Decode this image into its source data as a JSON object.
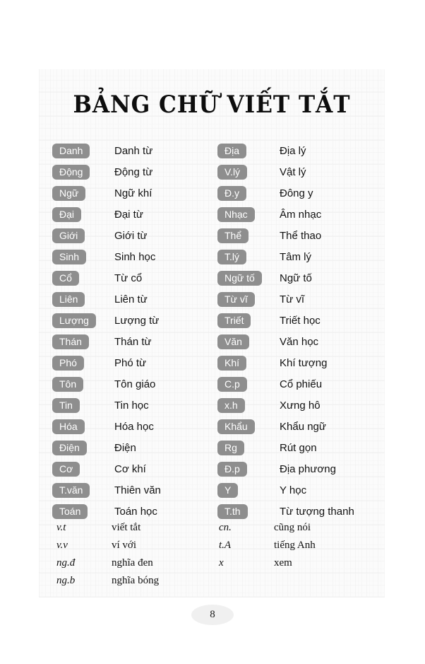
{
  "title": "BẢNG CHỮ VIẾT TẮT",
  "page_number": "8",
  "colors": {
    "badge_background": "#8e8e8e",
    "badge_text": "#ffffff",
    "definition_text": "#121212",
    "page_background": "#f7f7f7",
    "page_number_pill": "#f0f0f0"
  },
  "badge_columns": {
    "left": [
      {
        "abbr": "Danh",
        "definition": "Danh từ"
      },
      {
        "abbr": "Động",
        "definition": "Động từ"
      },
      {
        "abbr": "Ngữ",
        "definition": "Ngữ khí"
      },
      {
        "abbr": "Đại",
        "definition": "Đại từ"
      },
      {
        "abbr": "Giới",
        "definition": "Giới từ"
      },
      {
        "abbr": "Sinh",
        "definition": "Sinh học"
      },
      {
        "abbr": "Cổ",
        "definition": "Từ cổ"
      },
      {
        "abbr": "Liên",
        "definition": "Liên từ"
      },
      {
        "abbr": "Lượng",
        "definition": "Lượng từ"
      },
      {
        "abbr": "Thán",
        "definition": "Thán từ"
      },
      {
        "abbr": "Phó",
        "definition": "Phó từ"
      },
      {
        "abbr": "Tôn",
        "definition": "Tôn giáo"
      },
      {
        "abbr": "Tin",
        "definition": "Tin học"
      },
      {
        "abbr": "Hóa",
        "definition": "Hóa học"
      },
      {
        "abbr": "Điện",
        "definition": "Điện"
      },
      {
        "abbr": "Cơ",
        "definition": "Cơ khí"
      },
      {
        "abbr": "T.văn",
        "definition": "Thiên văn"
      },
      {
        "abbr": "Toán",
        "definition": "Toán học"
      }
    ],
    "right": [
      {
        "abbr": "Địa",
        "definition": "Địa lý"
      },
      {
        "abbr": "V.lý",
        "definition": "Vật lý"
      },
      {
        "abbr": "Đ.y",
        "definition": "Đông y"
      },
      {
        "abbr": "Nhạc",
        "definition": "Âm nhạc"
      },
      {
        "abbr": "Thể",
        "definition": "Thể thao"
      },
      {
        "abbr": "T.lý",
        "definition": "Tâm lý"
      },
      {
        "abbr": "Ngữ tố",
        "definition": "Ngữ tố"
      },
      {
        "abbr": "Từ vĩ",
        "definition": "Từ vĩ"
      },
      {
        "abbr": "Triết",
        "definition": "Triết học"
      },
      {
        "abbr": "Văn",
        "definition": "Văn học"
      },
      {
        "abbr": "Khí",
        "definition": "Khí tượng"
      },
      {
        "abbr": "C.p",
        "definition": "Cổ phiếu"
      },
      {
        "abbr": "x.h",
        "definition": "Xưng hô"
      },
      {
        "abbr": "Khẩu",
        "definition": "Khẩu ngữ"
      },
      {
        "abbr": "Rg",
        "definition": "Rút gọn"
      },
      {
        "abbr": "Đ.p",
        "definition": "Địa phương"
      },
      {
        "abbr": "Y",
        "definition": "Y học"
      },
      {
        "abbr": "T.th",
        "definition": "Từ tượng thanh"
      }
    ]
  },
  "serif_columns": {
    "left": [
      {
        "abbr": "v.t",
        "definition": "viết tắt"
      },
      {
        "abbr": "v.v",
        "definition": "ví với"
      },
      {
        "abbr": "ng.đ",
        "definition": "nghĩa đen"
      },
      {
        "abbr": "ng.b",
        "definition": "nghĩa bóng"
      }
    ],
    "right": [
      {
        "abbr": "cn.",
        "definition": "cũng nói"
      },
      {
        "abbr": "t.A",
        "definition": "tiếng Anh"
      },
      {
        "abbr": "x",
        "definition": "xem"
      }
    ]
  }
}
